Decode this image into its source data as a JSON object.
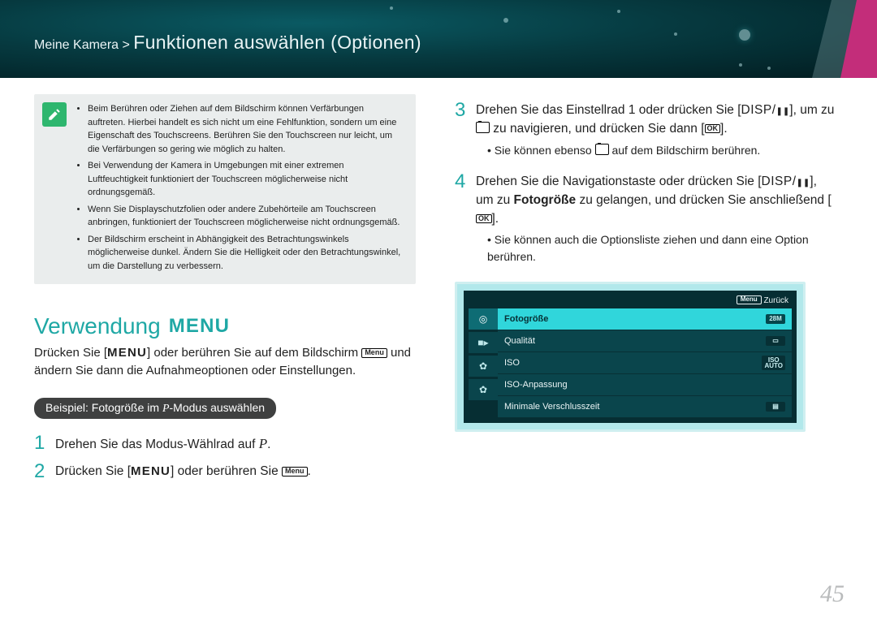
{
  "header": {
    "breadcrumb_small": "Meine Kamera > ",
    "breadcrumb_big": "Funktionen auswählen (Optionen)"
  },
  "note": {
    "items": [
      "Beim Berühren oder Ziehen auf dem Bildschirm können Verfärbungen auftreten. Hierbei handelt es sich nicht um eine Fehlfunktion, sondern um eine Eigenschaft des Touchscreens. Berühren Sie den Touchscreen nur leicht, um die Verfärbungen so gering wie möglich zu halten.",
      "Bei Verwendung der Kamera in Umgebungen mit einer extremen Luftfeuchtigkeit funktioniert der Touchscreen möglicherweise nicht ordnungsgemäß.",
      "Wenn Sie Displayschutzfolien oder andere Zubehörteile am Touchscreen anbringen, funktioniert der Touchscreen möglicherweise nicht ordnungsgemäß.",
      "Der Bildschirm erscheint in Abhängigkeit des Betrachtungswinkels möglicherweise dunkel. Ändern Sie die Helligkeit oder den Betrachtungswinkel, um die Darstellung zu verbessern."
    ]
  },
  "section": {
    "title": "Verwendung ",
    "menu_word": "MENU",
    "lead_a": "Drücken Sie [",
    "lead_b": "] oder berühren Sie auf dem Bildschirm ",
    "lead_c": " und ändern Sie dann die Aufnahmeoptionen oder Einstellungen."
  },
  "example": {
    "pill": "Beispiel: Fotogröße im P-Modus auswählen",
    "pill_prefix": "Beispiel: Fotogröße im ",
    "pill_p": "P",
    "pill_suffix": "-Modus auswählen"
  },
  "steps": {
    "s1": "Drehen Sie das Modus-Wählrad auf ",
    "s1_p": "P",
    "s1_end": ".",
    "s2_a": "Drücken Sie [",
    "s2_b": "] oder berühren Sie ",
    "s2_c": ".",
    "s3_a": "Drehen Sie das Einstellrad 1 oder drücken Sie [",
    "s3_disp": "DISP/",
    "s3_b": "], um zu ",
    "s3_c": " zu navigieren, und drücken Sie dann [",
    "s3_d": "].",
    "s3_sub": "Sie können ebenso ",
    "s3_sub2": " auf dem Bildschirm berühren.",
    "s4_a": "Drehen Sie die Navigationstaste oder drücken Sie [",
    "s4_b": "], um zu ",
    "s4_bold": "Fotogröße",
    "s4_c": " zu gelangen, und drücken Sie anschließend [",
    "s4_d": "].",
    "s4_sub": "Sie können auch die Optionsliste ziehen und dann eine Option berühren."
  },
  "screen": {
    "back": "Zurück",
    "menu": "Menu",
    "rows": [
      {
        "label": "Fotogröße",
        "val": "28M",
        "active": true
      },
      {
        "label": "Qualität",
        "val": "▭"
      },
      {
        "label": "ISO",
        "val": "ISO\nAUTO"
      },
      {
        "label": "ISO-Anpassung",
        "val": ""
      },
      {
        "label": "Minimale Verschlusszeit",
        "val": "▤"
      }
    ]
  },
  "ok_glyph": "OK",
  "pause_glyph": "❚❚",
  "down_glyph": "⬇",
  "pagenum": "45"
}
